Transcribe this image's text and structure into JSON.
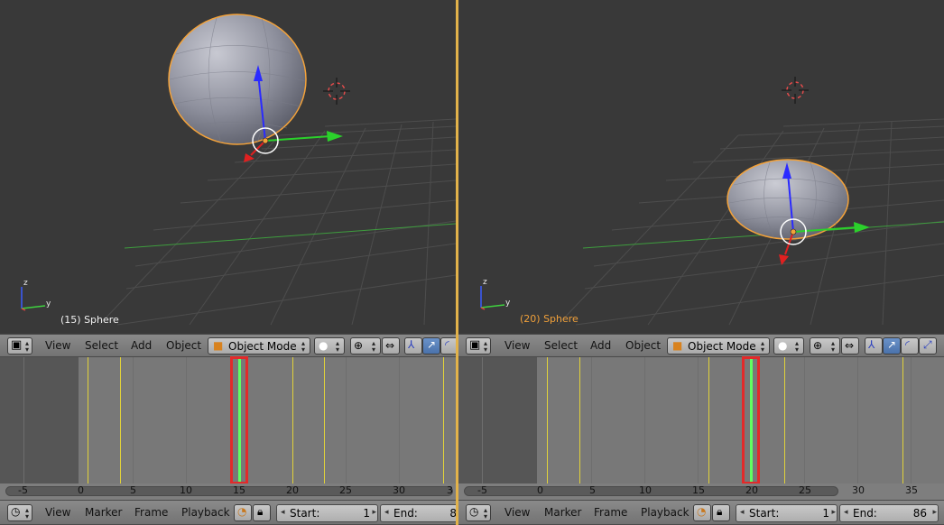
{
  "panes": [
    {
      "id": "left",
      "object_label": "(15) Sphere",
      "menu": [
        "View",
        "Select",
        "Add",
        "Object"
      ],
      "mode": "Object Mode",
      "ruler_ticks": [
        "-5",
        "0",
        "5",
        "10",
        "15",
        "20",
        "25",
        "30",
        "3"
      ],
      "timeline_menu": [
        "View",
        "Marker",
        "Frame",
        "Playback"
      ],
      "start_label": "Start:",
      "start_value": "1",
      "end_label": "End:",
      "end_value": "8",
      "current_frame": 15
    },
    {
      "id": "right",
      "object_label": "(20) Sphere",
      "menu": [
        "View",
        "Select",
        "Add",
        "Object"
      ],
      "mode": "Object Mode",
      "ruler_ticks": [
        "-5",
        "0",
        "5",
        "10",
        "15",
        "20",
        "25",
        "30",
        "35"
      ],
      "timeline_menu": [
        "View",
        "Marker",
        "Frame",
        "Playback"
      ],
      "start_label": "Start:",
      "start_value": "1",
      "end_label": "End:",
      "end_value": "86",
      "current_frame": 20
    }
  ],
  "colors": {
    "viewport_bg": "#393939",
    "selection_outline": "#f3a23a",
    "keyframe": "#e1d23a",
    "current_frame": "#60ff60",
    "highlight_box": "#e22a2a",
    "separator": "#e2b24a"
  },
  "icons": {
    "editor_type": "cube-icon",
    "mode": "orange-cube-icon",
    "viewport_shade": "sphere-icon",
    "pivot": "pivot-icon",
    "manipulator": "manipulator-icon",
    "translate": "translate-arrow-icon",
    "rotate": "rotate-arc-icon",
    "scale": "scale-icon",
    "timeline_editor": "clock-icon",
    "keying": "keying-set-icon",
    "lock": "lock-icon"
  }
}
